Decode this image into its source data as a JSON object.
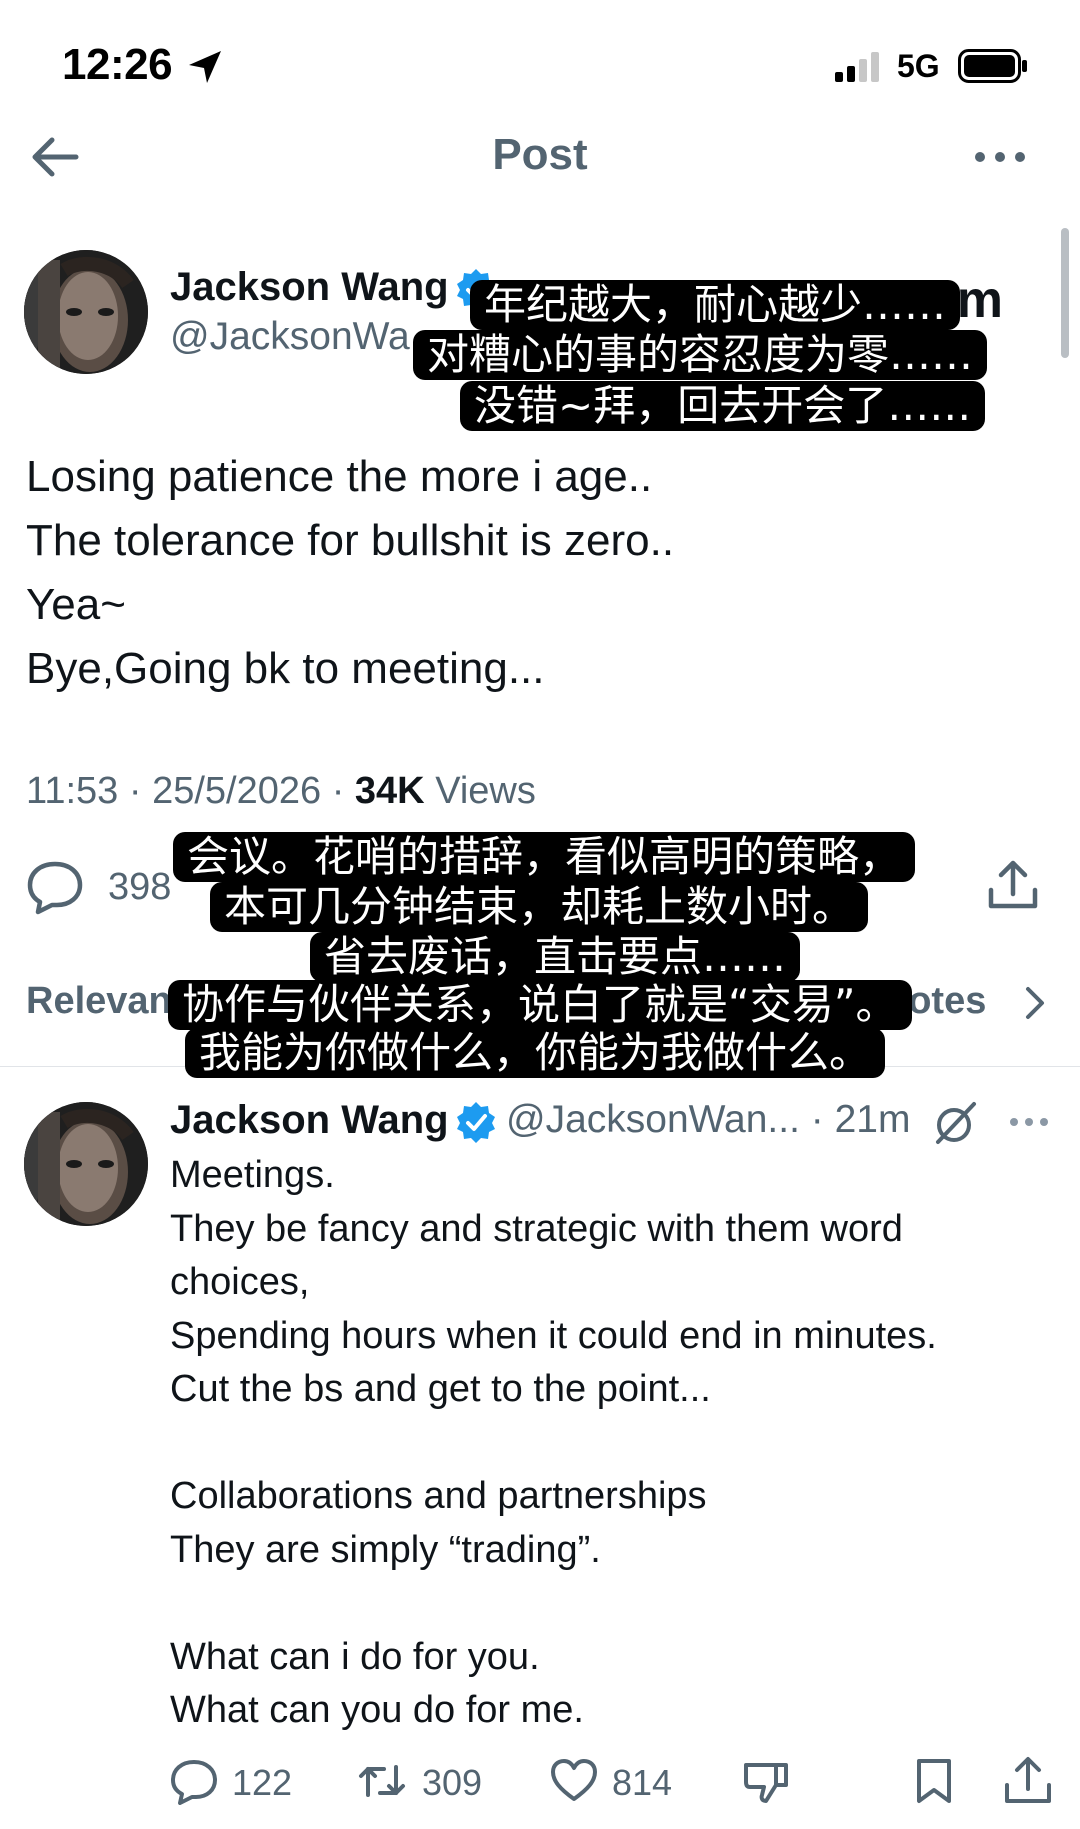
{
  "status_bar": {
    "time": "12:26",
    "network": "5G"
  },
  "header": {
    "title": "Post"
  },
  "main_post": {
    "author_name": "Jackson Wang",
    "handle": "@JacksonWa",
    "handle_trailing": "om",
    "lines": [
      "Losing patience the more i age..",
      "The tolerance for bullshit is zero..",
      "Yea~",
      "Bye,Going bk to meeting..."
    ],
    "time": "11:53",
    "date": "25/5/2026",
    "views_count": "34K",
    "views_label": "Views",
    "reply_count": "398"
  },
  "sort_bar": {
    "replies_label": "Relevan",
    "quotes_label": "uotes"
  },
  "reply_post": {
    "author_name": "Jackson Wang",
    "handle_time": "@JacksonWan... · 21m",
    "text": "Meetings.\nThey be fancy and strategic with them word choices,\nSpending hours when it could end in minutes.\nCut the bs and get to the point...\n\nCollaborations and partnerships\nThey are simply “trading”.\n\nWhat can i do for you.\nWhat can you do for me.",
    "reply_count": "122",
    "repost_count": "309",
    "like_count": "814"
  },
  "subtitles": {
    "block1": [
      "年纪越大，耐心越少……",
      "对糟心的事的容忍度为零……",
      "没错~拜，回去开会了……"
    ],
    "block2": [
      "会议。花哨的措辞，看似高明的策略，",
      "本可几分钟结束，却耗上数小时。",
      "省去废话，直击要点……",
      "协作与伙伴关系，说白了就是“交易”。",
      "我能为你做什么，你能为我做什么。"
    ]
  },
  "colors": {
    "accent": "#1d9bf0",
    "secondary_text": "#536471",
    "primary_text": "#0f1419"
  }
}
